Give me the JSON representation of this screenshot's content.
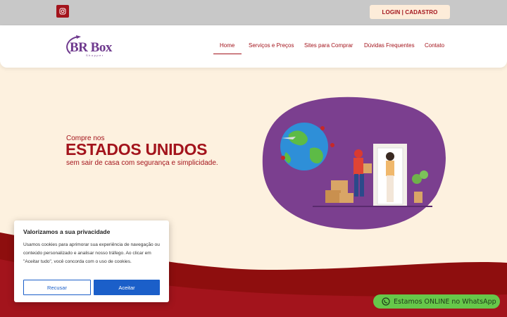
{
  "topbar": {
    "instagram_icon": "instagram-icon",
    "login_label": "LOGIN | CADASTRO"
  },
  "header": {
    "logo": {
      "text": "BR Box",
      "sub": "Shopper"
    },
    "nav": [
      {
        "label": "Home",
        "active": true
      },
      {
        "label": "Serviços e Preços",
        "active": false
      },
      {
        "label": "Sites para Comprar",
        "active": false
      },
      {
        "label": "Dúvidas Frequentes",
        "active": false
      },
      {
        "label": "Contato",
        "active": false
      }
    ]
  },
  "hero": {
    "small": "Compre nos",
    "big": "ESTADOS UNIDOS",
    "sub": "sem sair de casa com segurança e simplicidade."
  },
  "cookie": {
    "title": "Valorizamos a sua privacidade",
    "text": "Usamos cookies para aprimorar sua experiência de navegação ou conteúdo personalizado e analisar nosso tráfego. Ao clicar em \"Aceitar tudo\", você concorda com o uso de cookies.",
    "reject_label": "Recusar",
    "accept_label": "Aceitar"
  },
  "whatsapp": {
    "label": "Estamos ONLINE no WhatsApp",
    "icon": "whatsapp-icon"
  },
  "colors": {
    "brand_red": "#a3141c",
    "brand_purple": "#7b3f8f",
    "background": "#fdf1df",
    "cookie_blue": "#1b5fc9",
    "whatsapp_green": "#66c84a"
  }
}
